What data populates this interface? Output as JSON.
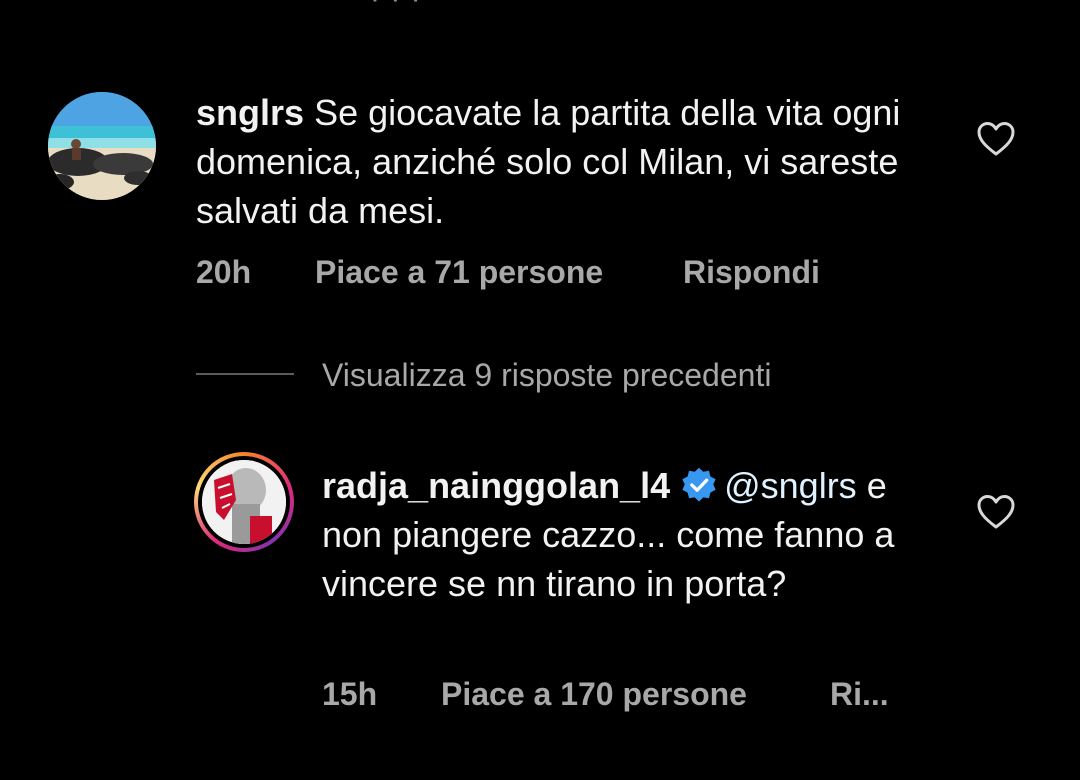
{
  "comment1": {
    "username": "snglrs",
    "text": "Se giocavate la partita della vita ogni domenica, anziché solo col Milan, vi sareste salvati da mesi.",
    "time": "20h",
    "likes": "Piace a 71 persone",
    "reply": "Rispondi",
    "avatar_icon": "beach-photo-avatar",
    "like_icon": "heart-outline-icon"
  },
  "view_replies": {
    "label": "Visualizza 9 risposte precedenti"
  },
  "comment2": {
    "username": "radja_nainggolan_l4",
    "verified_icon": "verified-badge-icon",
    "mention": "@snglrs",
    "text": "e non piangere cazzo... come fanno a vincere se nn tirano in porta?",
    "time": "15h",
    "likes": "Piace a 170 persone",
    "reply": "Ri...",
    "avatar_icon": "story-ring-avatar",
    "like_icon": "heart-outline-icon"
  },
  "colors": {
    "background": "#000000",
    "text": "#f2f2f2",
    "secondary": "#a8a8a8",
    "verified": "#3897f0",
    "story_ring": [
      "#f58529",
      "#dd2a7b",
      "#8134af"
    ]
  }
}
